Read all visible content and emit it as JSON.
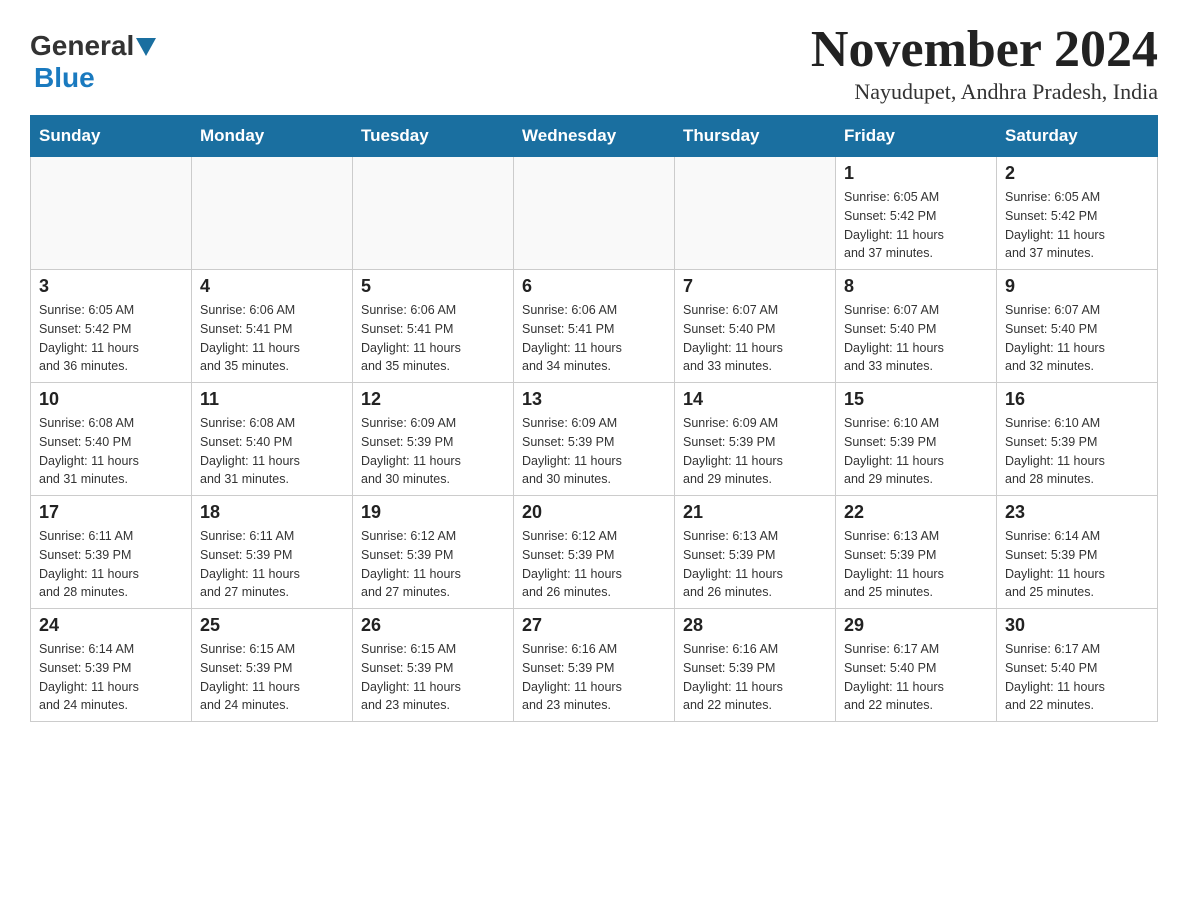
{
  "logo": {
    "text1": "General",
    "text2": "Blue"
  },
  "title": "November 2024",
  "subtitle": "Nayudupet, Andhra Pradesh, India",
  "weekdays": [
    "Sunday",
    "Monday",
    "Tuesday",
    "Wednesday",
    "Thursday",
    "Friday",
    "Saturday"
  ],
  "weeks": [
    [
      {
        "day": "",
        "info": ""
      },
      {
        "day": "",
        "info": ""
      },
      {
        "day": "",
        "info": ""
      },
      {
        "day": "",
        "info": ""
      },
      {
        "day": "",
        "info": ""
      },
      {
        "day": "1",
        "info": "Sunrise: 6:05 AM\nSunset: 5:42 PM\nDaylight: 11 hours\nand 37 minutes."
      },
      {
        "day": "2",
        "info": "Sunrise: 6:05 AM\nSunset: 5:42 PM\nDaylight: 11 hours\nand 37 minutes."
      }
    ],
    [
      {
        "day": "3",
        "info": "Sunrise: 6:05 AM\nSunset: 5:42 PM\nDaylight: 11 hours\nand 36 minutes."
      },
      {
        "day": "4",
        "info": "Sunrise: 6:06 AM\nSunset: 5:41 PM\nDaylight: 11 hours\nand 35 minutes."
      },
      {
        "day": "5",
        "info": "Sunrise: 6:06 AM\nSunset: 5:41 PM\nDaylight: 11 hours\nand 35 minutes."
      },
      {
        "day": "6",
        "info": "Sunrise: 6:06 AM\nSunset: 5:41 PM\nDaylight: 11 hours\nand 34 minutes."
      },
      {
        "day": "7",
        "info": "Sunrise: 6:07 AM\nSunset: 5:40 PM\nDaylight: 11 hours\nand 33 minutes."
      },
      {
        "day": "8",
        "info": "Sunrise: 6:07 AM\nSunset: 5:40 PM\nDaylight: 11 hours\nand 33 minutes."
      },
      {
        "day": "9",
        "info": "Sunrise: 6:07 AM\nSunset: 5:40 PM\nDaylight: 11 hours\nand 32 minutes."
      }
    ],
    [
      {
        "day": "10",
        "info": "Sunrise: 6:08 AM\nSunset: 5:40 PM\nDaylight: 11 hours\nand 31 minutes."
      },
      {
        "day": "11",
        "info": "Sunrise: 6:08 AM\nSunset: 5:40 PM\nDaylight: 11 hours\nand 31 minutes."
      },
      {
        "day": "12",
        "info": "Sunrise: 6:09 AM\nSunset: 5:39 PM\nDaylight: 11 hours\nand 30 minutes."
      },
      {
        "day": "13",
        "info": "Sunrise: 6:09 AM\nSunset: 5:39 PM\nDaylight: 11 hours\nand 30 minutes."
      },
      {
        "day": "14",
        "info": "Sunrise: 6:09 AM\nSunset: 5:39 PM\nDaylight: 11 hours\nand 29 minutes."
      },
      {
        "day": "15",
        "info": "Sunrise: 6:10 AM\nSunset: 5:39 PM\nDaylight: 11 hours\nand 29 minutes."
      },
      {
        "day": "16",
        "info": "Sunrise: 6:10 AM\nSunset: 5:39 PM\nDaylight: 11 hours\nand 28 minutes."
      }
    ],
    [
      {
        "day": "17",
        "info": "Sunrise: 6:11 AM\nSunset: 5:39 PM\nDaylight: 11 hours\nand 28 minutes."
      },
      {
        "day": "18",
        "info": "Sunrise: 6:11 AM\nSunset: 5:39 PM\nDaylight: 11 hours\nand 27 minutes."
      },
      {
        "day": "19",
        "info": "Sunrise: 6:12 AM\nSunset: 5:39 PM\nDaylight: 11 hours\nand 27 minutes."
      },
      {
        "day": "20",
        "info": "Sunrise: 6:12 AM\nSunset: 5:39 PM\nDaylight: 11 hours\nand 26 minutes."
      },
      {
        "day": "21",
        "info": "Sunrise: 6:13 AM\nSunset: 5:39 PM\nDaylight: 11 hours\nand 26 minutes."
      },
      {
        "day": "22",
        "info": "Sunrise: 6:13 AM\nSunset: 5:39 PM\nDaylight: 11 hours\nand 25 minutes."
      },
      {
        "day": "23",
        "info": "Sunrise: 6:14 AM\nSunset: 5:39 PM\nDaylight: 11 hours\nand 25 minutes."
      }
    ],
    [
      {
        "day": "24",
        "info": "Sunrise: 6:14 AM\nSunset: 5:39 PM\nDaylight: 11 hours\nand 24 minutes."
      },
      {
        "day": "25",
        "info": "Sunrise: 6:15 AM\nSunset: 5:39 PM\nDaylight: 11 hours\nand 24 minutes."
      },
      {
        "day": "26",
        "info": "Sunrise: 6:15 AM\nSunset: 5:39 PM\nDaylight: 11 hours\nand 23 minutes."
      },
      {
        "day": "27",
        "info": "Sunrise: 6:16 AM\nSunset: 5:39 PM\nDaylight: 11 hours\nand 23 minutes."
      },
      {
        "day": "28",
        "info": "Sunrise: 6:16 AM\nSunset: 5:39 PM\nDaylight: 11 hours\nand 22 minutes."
      },
      {
        "day": "29",
        "info": "Sunrise: 6:17 AM\nSunset: 5:40 PM\nDaylight: 11 hours\nand 22 minutes."
      },
      {
        "day": "30",
        "info": "Sunrise: 6:17 AM\nSunset: 5:40 PM\nDaylight: 11 hours\nand 22 minutes."
      }
    ]
  ]
}
